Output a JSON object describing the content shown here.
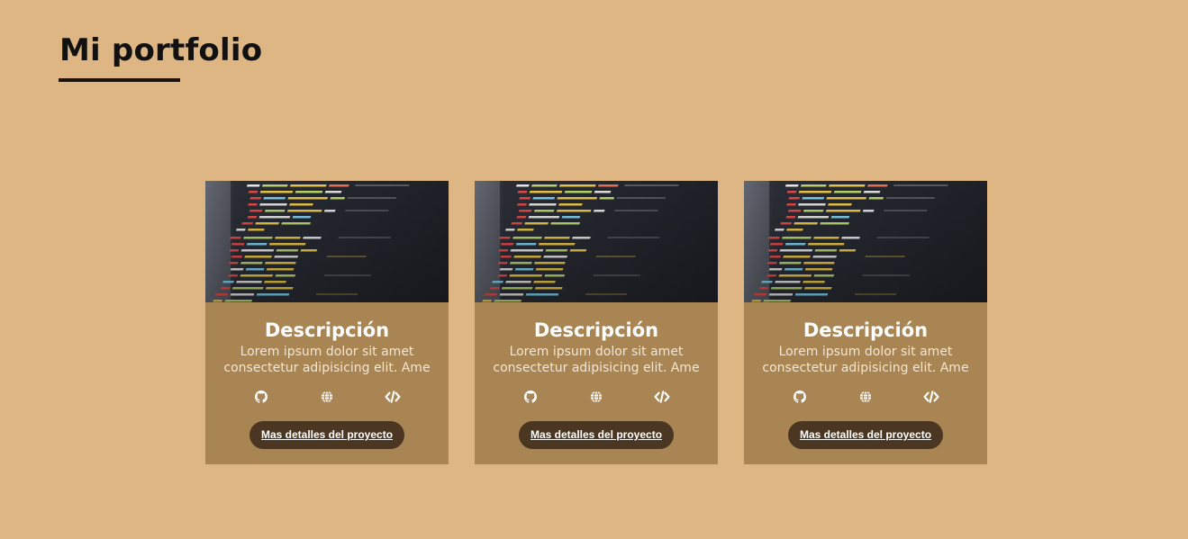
{
  "header": {
    "title": "Mi portfolio"
  },
  "colors": {
    "background": "#ddb684",
    "card": "#a98554",
    "button": "#4a3621",
    "underline": "#1c1308"
  },
  "cards": [
    {
      "image": "code-screenshot-image",
      "title": "Descripción",
      "text": "Lorem ipsum dolor sit amet consectetur adipisicing elit. Ame",
      "icons": [
        "github-icon",
        "globe-icon",
        "code-icon"
      ],
      "button_label": "Mas detalles del proyecto"
    },
    {
      "image": "code-screenshot-image",
      "title": "Descripción",
      "text": "Lorem ipsum dolor sit amet consectetur adipisicing elit. Ame",
      "icons": [
        "github-icon",
        "globe-icon",
        "code-icon"
      ],
      "button_label": "Mas detalles del proyecto"
    },
    {
      "image": "code-screenshot-image",
      "title": "Descripción",
      "text": "Lorem ipsum dolor sit amet consectetur adipisicing elit. Ame",
      "icons": [
        "github-icon",
        "globe-icon",
        "code-icon"
      ],
      "button_label": "Mas detalles del proyecto"
    }
  ]
}
